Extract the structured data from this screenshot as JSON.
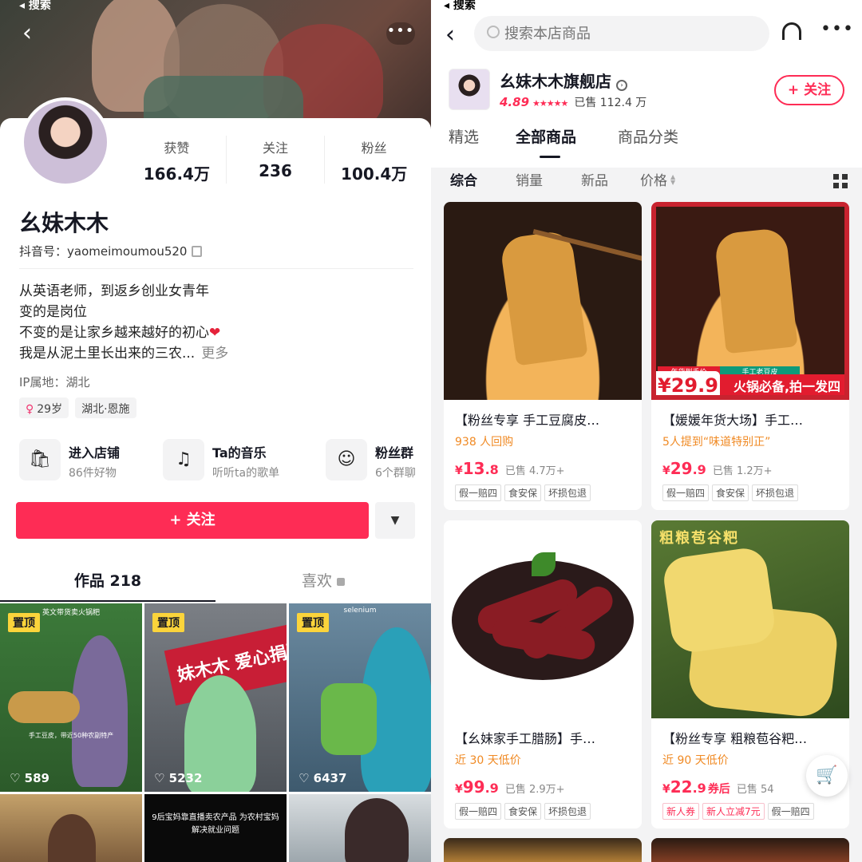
{
  "left_status": "◂ 搜索",
  "right_status": "◂ 搜索",
  "profile": {
    "back_icon": "‹",
    "more_icon": "•••",
    "stats": [
      {
        "label": "获赞",
        "value": "166.4万"
      },
      {
        "label": "关注",
        "value": "236"
      },
      {
        "label": "粉丝",
        "value": "100.4万"
      }
    ],
    "name": "幺妹木木",
    "douyin_id": "抖音号：yaomeimoumou520",
    "bio_lines": [
      "从英语老师，到返乡创业女青年",
      "变的是岗位",
      "不变的是让家乡越来越好的初心",
      "我是从泥土里长出来的三农..."
    ],
    "bio_heart": "❤",
    "bio_more": "更多",
    "ip": "IP属地：湖北",
    "tags": {
      "age": "29岁",
      "age_icon": "♀",
      "region": "湖北·恩施"
    },
    "entries": [
      {
        "title": "进入店铺",
        "sub": "86件好物",
        "icon": "shopping-bag-icon",
        "glyph": "🛍"
      },
      {
        "title": "Ta的音乐",
        "sub": "听听ta的歌单",
        "icon": "music-note-icon",
        "glyph": "♫"
      },
      {
        "title": "粉丝群",
        "sub": "6个群聊",
        "icon": "fan-group-icon",
        "glyph": "☺"
      }
    ],
    "follow_label": "+ 关注",
    "dropdown_icon": "▼",
    "tab_works": "作品 218",
    "tab_likes": "喜欢",
    "videos": [
      {
        "pinned": "置顶",
        "likes": "♡ 589",
        "caption": "英文带货卖火锅粑",
        "caption2": "手工豆皮，带近50种农副特产"
      },
      {
        "pinned": "置顶",
        "likes": "♡ 5232",
        "banner": "妹木木 爱心捐赠"
      },
      {
        "pinned": "置顶",
        "likes": "♡ 6437",
        "caption": "selenium"
      },
      {
        "caption": ""
      },
      {
        "caption": "9后宝妈靠直播卖农产品 为农村宝妈解决就业问题"
      },
      {
        "caption": ""
      }
    ]
  },
  "store": {
    "back_icon": "‹",
    "search_placeholder": "搜索本店商品",
    "more_icon": "•••",
    "shop_name": "幺妹木木旗舰店",
    "rating": "4.89",
    "stars": "★★★★★",
    "sold": "已售 112.4 万",
    "follow_label": "+ 关注",
    "tabs": [
      "精选",
      "全部商品",
      "商品分类"
    ],
    "sorts": [
      "综合",
      "销量",
      "新品",
      "价格"
    ],
    "products": [
      {
        "title": "【粉丝专享 手工豆腐皮…",
        "sub": "938 人回购",
        "price_yen": "¥",
        "price_int": "13",
        "price_dec": ".8",
        "coupon": "",
        "sold": "已售 4.7万+",
        "badges": [
          "假一赔四",
          "食安保",
          "坏损包退"
        ]
      },
      {
        "title": "【媛媛年货大场】手工…",
        "sub": "5人提到“味道特别正”",
        "price_yen": "¥",
        "price_int": "29",
        "price_dec": ".9",
        "coupon": "",
        "sold": "已售 1.2万+",
        "badges": [
          "假一赔四",
          "食安保",
          "坏损包退"
        ],
        "img_price": "¥29.9",
        "img_slogan": "火锅必备,拍一发四",
        "img_mini1": "年货到手价",
        "img_mini2": "手工老豆皮"
      },
      {
        "title": "【幺妹家手工腊肠】手…",
        "sub": "近 30 天低价",
        "price_yen": "¥",
        "price_int": "99",
        "price_dec": ".9",
        "coupon": "",
        "sold": "已售 2.9万+",
        "badges": [
          "假一赔四",
          "食安保",
          "坏损包退"
        ]
      },
      {
        "title": "【粉丝专享 粗粮苞谷粑…",
        "sub": "近 90 天低价",
        "price_yen": "¥",
        "price_int": "22",
        "price_dec": ".9",
        "coupon": "券后",
        "sold": "已售 54",
        "badges": [
          "新人券",
          "新人立减7元",
          "假一赔四"
        ],
        "img_label": "粗粮苞谷粑"
      }
    ],
    "cart_icon": "🛒"
  },
  "colors": {
    "brand": "#fe2c55",
    "pin": "#fbd43b",
    "orange": "#f08a24"
  }
}
